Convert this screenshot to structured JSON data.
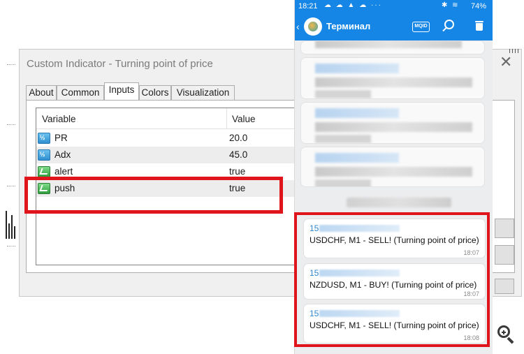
{
  "dialog": {
    "title": "Custom Indicator - Turning point of price",
    "close_glyph": "✕",
    "tabs": [
      {
        "label": "About"
      },
      {
        "label": "Common"
      },
      {
        "label": "Inputs"
      },
      {
        "label": "Colors"
      },
      {
        "label": "Visualization"
      }
    ],
    "active_tab": "Inputs",
    "grid": {
      "headers": {
        "variable": "Variable",
        "value": "Value"
      },
      "rows": [
        {
          "name": "PR",
          "value": "20.0",
          "icon": "numeric-param-icon",
          "icon_text": "½"
        },
        {
          "name": "Adx",
          "value": "45.0",
          "icon": "numeric-param-icon",
          "icon_text": "½"
        },
        {
          "name": "alert",
          "value": "true",
          "icon": "bool-param-icon"
        },
        {
          "name": "push",
          "value": "true",
          "icon": "bool-param-icon"
        }
      ]
    },
    "highlight_color": "#e0151c"
  },
  "phone": {
    "status": {
      "time": "18:21",
      "battery": "74%"
    },
    "app": {
      "title": "Терминал",
      "mqid_label": "MQID",
      "back_glyph": "‹"
    },
    "accent": "#1686e6",
    "messages": [
      {
        "sender": "15",
        "text": "USDCHF, M1 - SELL! (Turning point of price)",
        "time": "18:07"
      },
      {
        "sender": "15",
        "text": "NZDUSD, M1 - BUY! (Turning point of price)",
        "time": "18:07"
      },
      {
        "sender": "15",
        "text": "USDCHF, M1 - SELL! (Turning point of price)",
        "time": "18:08"
      }
    ]
  }
}
